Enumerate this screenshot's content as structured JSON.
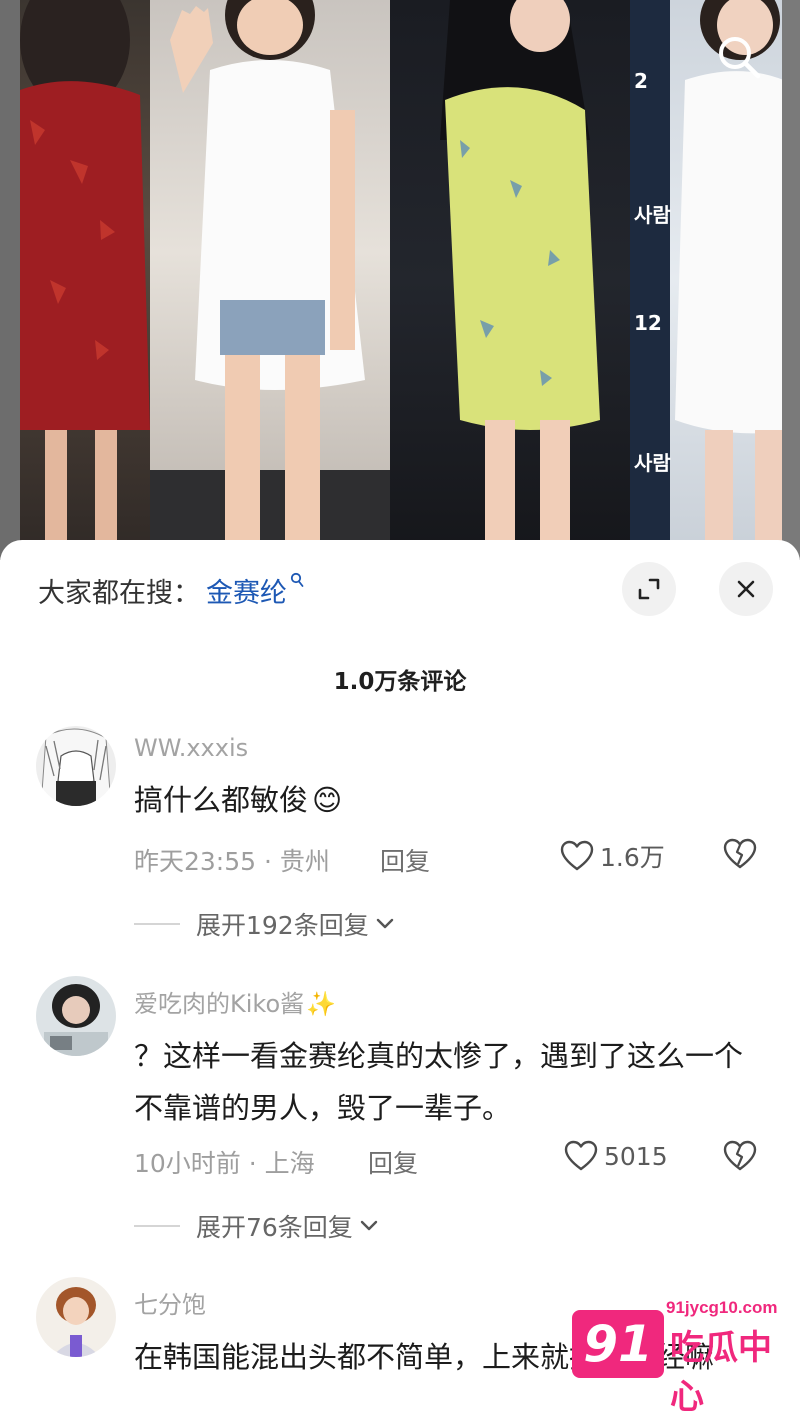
{
  "sheet": {
    "hot_search_label": "大家都在搜：",
    "hot_search_term": "金赛纶",
    "comment_count_title": "1.0万条评论"
  },
  "comments": [
    {
      "user": "WW.xxxis",
      "text": "搞什么都敏俊",
      "emoji": "😊",
      "time_location": "昨天23:55 · 贵州",
      "reply_label": "回复",
      "likes": "1.6万",
      "expand_label": "展开192条回复"
    },
    {
      "user": "爱吃肉的Kiko酱",
      "user_emoji": "✨",
      "text": "？这样一看金赛纶真的太惨了，遇到了这么一个不靠谱的男人，毁了一辈子。",
      "time_location": "10小时前 · 上海",
      "reply_label": "回复",
      "likes": "5015",
      "expand_label": "展开76条回复"
    },
    {
      "user": "七分饱",
      "text": "在韩国能混出头都不简单，上来就指望曾经嘛"
    }
  ],
  "watermark": {
    "badge": "91",
    "url": "91jycg10.com",
    "name": "吃瓜中心"
  },
  "colors": {
    "link_blue": "#1d58b4",
    "watermark_pink": "#f0287d"
  },
  "icons": [
    "search-icon",
    "collapse-icon",
    "close-icon",
    "heart-icon",
    "broken-heart-icon",
    "chevron-down-icon"
  ]
}
